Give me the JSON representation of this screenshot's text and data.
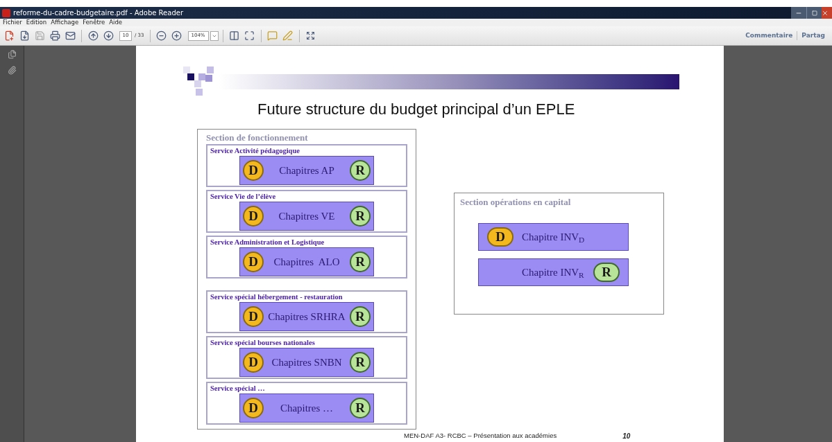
{
  "window": {
    "title": "reforme-du-cadre-budgetaire.pdf - Adobe Reader"
  },
  "menu": [
    "Fichier",
    "Edition",
    "Affichage",
    "Fenêtre",
    "Aide"
  ],
  "toolbar": {
    "page_field": "10",
    "page_total": "/ 33",
    "zoom_field": "104%",
    "right_buttons": [
      "Commentaire",
      "Partag"
    ]
  },
  "slide": {
    "title": "Future structure du budget principal d’un EPLE",
    "left_section": {
      "title": "Section de fonctionnement",
      "services": [
        {
          "title": "Service Activité pédagogique",
          "chapter": "Chapitres AP",
          "badges": [
            {
              "kind": "expense",
              "letter": "D"
            },
            {
              "kind": "revenue",
              "letter": "R"
            }
          ]
        },
        {
          "title": "Service Vie de l’élève",
          "chapter": "Chapitres VE",
          "badges": [
            {
              "kind": "expense",
              "letter": "D"
            },
            {
              "kind": "revenue",
              "letter": "R"
            }
          ]
        },
        {
          "title": "Service Administration et Logistique",
          "chapter": "Chapitres  ALO",
          "badges": [
            {
              "kind": "expense",
              "letter": "D"
            },
            {
              "kind": "revenue",
              "letter": "R"
            }
          ]
        },
        {
          "title": "Service spécial hébergement - restauration",
          "chapter": "Chapitres SRHRA",
          "badges": [
            {
              "kind": "expense",
              "letter": "D"
            },
            {
              "kind": "revenue",
              "letter": "R"
            }
          ]
        },
        {
          "title": "Service spécial bourses nationales",
          "chapter": "Chapitres SNBN",
          "badges": [
            {
              "kind": "expense",
              "letter": "D"
            },
            {
              "kind": "revenue",
              "letter": "R"
            }
          ]
        },
        {
          "title": "Service spécial …",
          "chapter": "Chapitres …",
          "badges": [
            {
              "kind": "expense",
              "letter": "D"
            },
            {
              "kind": "revenue",
              "letter": "R"
            }
          ]
        }
      ]
    },
    "right_section": {
      "title": "Section opérations en capital",
      "chapters": [
        {
          "label": "Chapitre INV$_{D}$",
          "badge": {
            "kind": "expense",
            "letter": "D"
          }
        },
        {
          "label": "Chapitre INV$_{R}$",
          "badge": {
            "kind": "revenue",
            "letter": "R"
          }
        }
      ]
    },
    "footer": "MEN-DAF A3- RCBC – Présentation aux académies",
    "page_number": "10"
  }
}
